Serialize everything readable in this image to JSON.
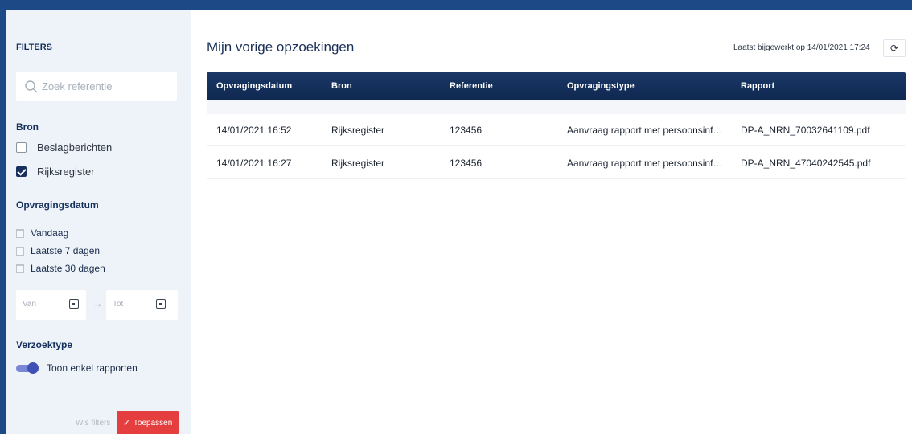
{
  "sidebar": {
    "title": "FILTERS",
    "search": {
      "placeholder": "Zoek referentie"
    },
    "bron": {
      "label": "Bron",
      "options": [
        {
          "label": "Beslagberichten",
          "checked": false
        },
        {
          "label": "Rijksregister",
          "checked": true
        }
      ]
    },
    "opvragingsdatum": {
      "label": "Opvragingsdatum",
      "options": [
        "Vandaag",
        "Laatste 7 dagen",
        "Laatste 30 dagen"
      ],
      "from_placeholder": "Van",
      "to_placeholder": "Tot",
      "arrow": "→"
    },
    "verzoektype": {
      "label": "Verzoektype",
      "toggle_label": "Toon enkel rapporten",
      "toggle_on": true
    },
    "clear_label": "Wis filters",
    "apply_label": "Toepassen"
  },
  "main": {
    "title": "Mijn vorige opzoekingen",
    "updated": "Laatst bijgewerkt op 14/01/2021 17:24",
    "refresh_icon": "refresh-icon",
    "table": {
      "headers": [
        "Opvragingsdatum",
        "Bron",
        "Referentie",
        "Opvragingstype",
        "Rapport"
      ],
      "rows": [
        [
          "14/01/2021 16:52",
          "Rijksregister",
          "123456",
          "Aanvraag rapport met persoonsinf…",
          "DP-A_NRN_70032641109.pdf"
        ],
        [
          "14/01/2021 16:27",
          "Rijksregister",
          "123456",
          "Aanvraag rapport met persoonsinf…",
          "DP-A_NRN_47040242545.pdf"
        ]
      ]
    }
  },
  "colors": {
    "frame": "#1d4a86",
    "sidebar_bg": "#eef3f9",
    "table_header": "#0f2850",
    "apply_button": "#e53e3e",
    "toggle": "#3f51b5"
  }
}
